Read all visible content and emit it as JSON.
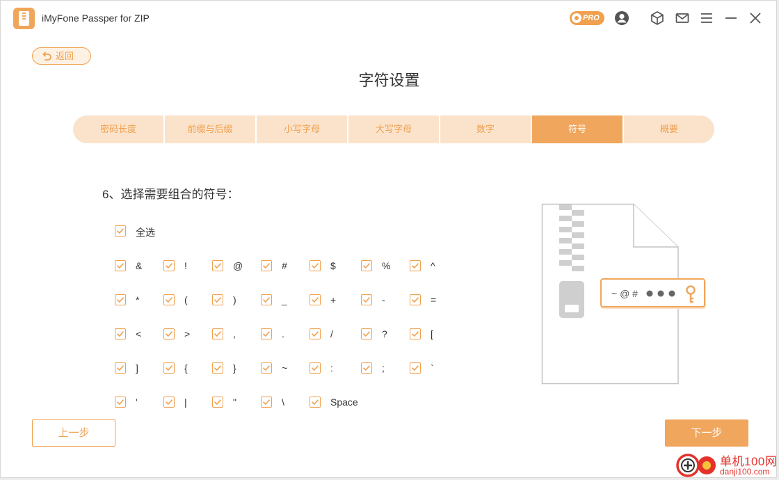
{
  "app": {
    "title": "iMyFone Passper for ZIP",
    "badge": "PRO"
  },
  "colors": {
    "accent": "#f0a04e",
    "tab_bg": "#fbe3cb",
    "tab_active": "#f0a65c"
  },
  "toolbar_icons": [
    "account-icon",
    "package-icon",
    "mail-icon",
    "menu-icon",
    "minimize-icon",
    "close-icon"
  ],
  "back": {
    "label": "返回"
  },
  "page": {
    "title": "字符设置"
  },
  "steps": [
    {
      "label": "密码长度",
      "active": false
    },
    {
      "label": "前缀与后缀",
      "active": false
    },
    {
      "label": "小写字母",
      "active": false
    },
    {
      "label": "大写字母",
      "active": false
    },
    {
      "label": "数字",
      "active": false
    },
    {
      "label": "符号",
      "active": true
    },
    {
      "label": "概要",
      "active": false
    }
  ],
  "question": "6、选择需要组合的符号：",
  "select_all": {
    "label": "全选",
    "checked": true
  },
  "symbols": [
    [
      "&",
      "!",
      "@",
      "#",
      "$",
      "%",
      "^"
    ],
    [
      "*",
      "(",
      ")",
      "_",
      "+",
      "-",
      "="
    ],
    [
      "<",
      ">",
      ",",
      ".",
      "/",
      "?",
      "["
    ],
    [
      "]",
      "{",
      "}",
      "~",
      ":",
      ";",
      "`"
    ],
    [
      "'",
      "|",
      "\"",
      "\\",
      "Space"
    ]
  ],
  "illustration": {
    "password_text": "~ @ #"
  },
  "buttons": {
    "prev": "上一步",
    "next": "下一步"
  },
  "watermark": {
    "line1": "单机100网",
    "line2": "danji100.com"
  }
}
